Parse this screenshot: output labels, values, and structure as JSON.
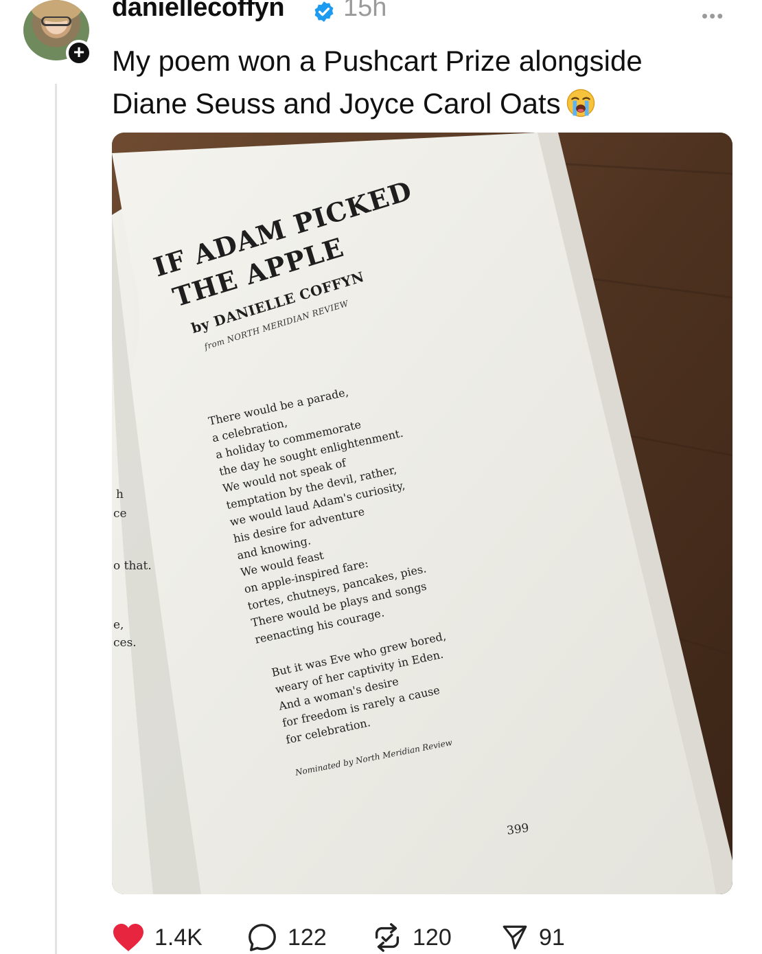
{
  "post": {
    "username": "daniellecoffyn",
    "time": "15h",
    "text_line1": "My poem won a Pushcart Prize alongside",
    "text_line2": "Diane Seuss and Joyce Carol Oats",
    "emoji_icon": "loudly-crying-face-icon"
  },
  "book": {
    "title_line1": "IF ADAM PICKED",
    "title_line2": "THE APPLE",
    "byline": "by DANIELLE COFFYN",
    "source": "from NORTH MERIDIAN REVIEW",
    "stanza1": [
      "There would be a parade,",
      "a celebration,",
      "a holiday to commemorate",
      "the day he sought enlightenment.",
      "We would not speak of",
      "temptation by the devil, rather,",
      "we would laud Adam's curiosity,",
      "his desire for adventure",
      "and knowing.",
      "We would feast",
      "on apple-inspired fare:",
      "tortes, chutneys, pancakes, pies.",
      "There would be plays and songs",
      "reenacting his courage."
    ],
    "stanza2": [
      "But it was Eve who grew bored,",
      "weary of her captivity in Eden.",
      "And a woman's desire",
      "for freedom is rarely a cause",
      "for celebration."
    ],
    "nominated": "Nominated by North Meridian Review",
    "page_number": "399",
    "left_page_fragments": [
      "h",
      "ce",
      "o that.",
      "e,",
      "ces."
    ]
  },
  "actions": {
    "likes": "1.4K",
    "replies": "122",
    "reposts": "120",
    "shares": "91"
  },
  "colors": {
    "like_red": "#e8253e",
    "verified_blue": "#1d9bf0",
    "muted_gray": "#9a9a9a"
  }
}
